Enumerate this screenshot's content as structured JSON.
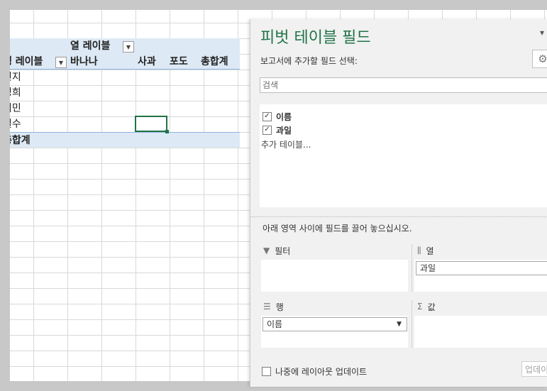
{
  "pivot_table": {
    "col_label_header": "열 레이블",
    "row_label_header": "행 레이블",
    "columns": [
      "바나나",
      "사과",
      "포도",
      "총합계"
    ],
    "rows": [
      "민지",
      "영희",
      "지민",
      "철수"
    ],
    "grand_total_label": "총합계"
  },
  "pane": {
    "title": "피벗 테이블 필드",
    "menu_icon": "chevron-down-icon",
    "subtitle": "보고서에 추가할 필드 선택:",
    "settings_icon": "gear-icon",
    "search_placeholder": "검색",
    "fields": [
      {
        "label": "이름",
        "checked": true
      },
      {
        "label": "과일",
        "checked": true
      }
    ],
    "more_tables": "추가 테이블...",
    "drag_hint": "아래 영역 사이에 필드를 끌어 놓으십시오.",
    "areas": {
      "filter": {
        "label": "필터",
        "icon": "filter-icon"
      },
      "columns": {
        "label": "열",
        "icon": "columns-icon",
        "chip": "과일"
      },
      "rows": {
        "label": "행",
        "icon": "rows-icon",
        "chip": "이름"
      },
      "values": {
        "label": "값",
        "icon": "sigma-icon"
      }
    },
    "defer_label": "나중에 레이아웃 업데이트",
    "update_label": "업데이트"
  },
  "colors": {
    "accent": "#217346",
    "pivot_highlight": "#dde9f5"
  }
}
